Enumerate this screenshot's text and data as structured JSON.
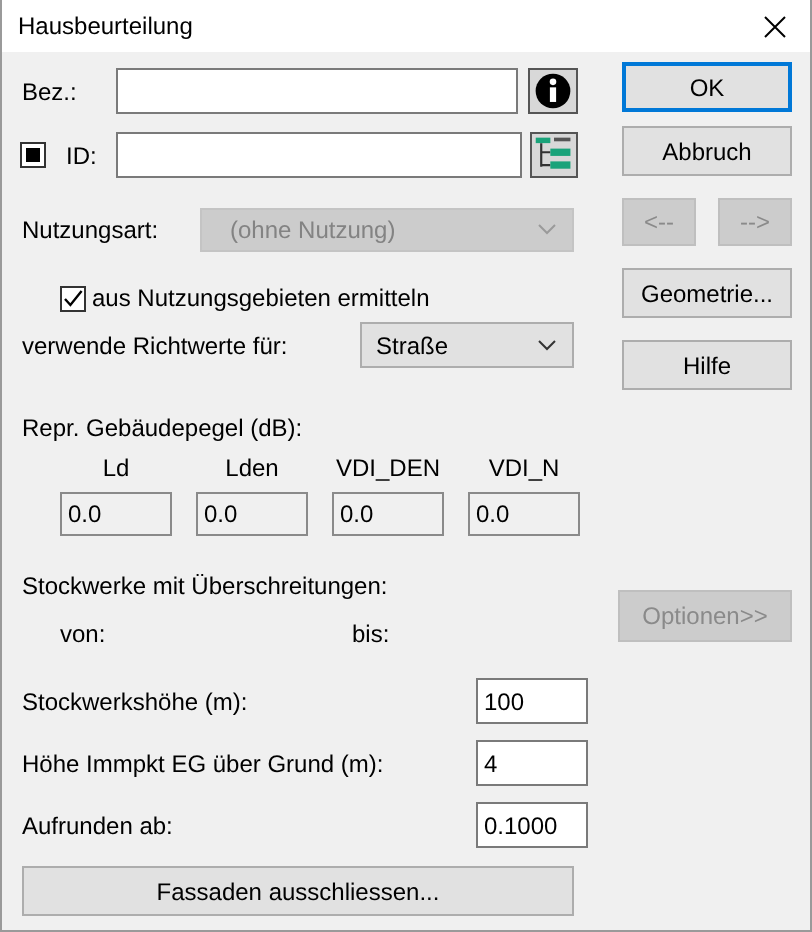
{
  "window": {
    "title": "Hausbeurteilung"
  },
  "bez": {
    "label": "Bez.:"
  },
  "id": {
    "label": "ID:",
    "indeterminate": true
  },
  "nutzungsart": {
    "label": "Nutzungsart:",
    "value": "(ohne Nutzung)",
    "disabled": true
  },
  "auto_checkbox": {
    "label": "aus Nutzungsgebieten ermitteln",
    "checked": true
  },
  "richtwerte": {
    "label": "verwende Richtwerte für:",
    "value": "Straße",
    "disabled": false
  },
  "pegel": {
    "title": "Repr. Gebäudepegel (dB):",
    "columns": [
      {
        "label": "Ld",
        "value": "0.0"
      },
      {
        "label": "Lden",
        "value": "0.0"
      },
      {
        "label": "VDI_DEN",
        "value": "0.0"
      },
      {
        "label": "VDI_N",
        "value": "0.0"
      }
    ]
  },
  "stockwerke": {
    "title": "Stockwerke mit Überschreitungen:",
    "from_label": "von:",
    "to_label": "bis:"
  },
  "params": [
    {
      "label": "Stockwerkshöhe (m):",
      "value": "100"
    },
    {
      "label": "Höhe Immpkt EG über Grund (m):",
      "value": "4"
    },
    {
      "label": "Aufrunden ab:",
      "value": "0.1000"
    }
  ],
  "fassaden_button": {
    "label": "Fassaden ausschliessen...",
    "disabled": false
  },
  "side_buttons": [
    {
      "kind": "single",
      "label": "OK",
      "default": true,
      "disabled": false
    },
    {
      "kind": "single",
      "label": "Abbruch",
      "default": false,
      "disabled": false
    },
    {
      "kind": "pair",
      "buttons": [
        {
          "label": "<--",
          "disabled": true
        },
        {
          "label": "-->",
          "disabled": true
        }
      ]
    },
    {
      "kind": "single",
      "label": "Geometrie...",
      "default": false,
      "disabled": false
    },
    {
      "kind": "single",
      "label": "Hilfe",
      "default": false,
      "disabled": false
    }
  ],
  "options_button": {
    "label": "Optionen>>",
    "disabled": true
  }
}
